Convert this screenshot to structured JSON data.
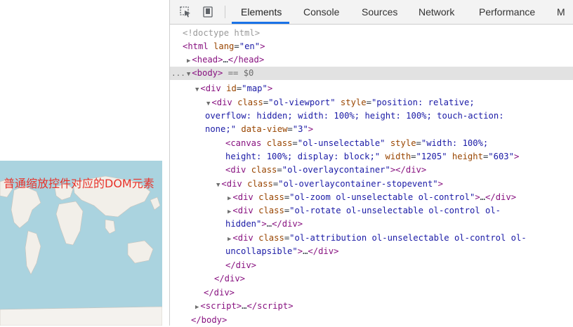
{
  "annotation": {
    "text": "普通缩放控件对应的DOM元素"
  },
  "devtools": {
    "tabs": [
      {
        "label": "Elements"
      },
      {
        "label": "Console"
      },
      {
        "label": "Sources"
      },
      {
        "label": "Network"
      },
      {
        "label": "Performance"
      },
      {
        "label": "M"
      }
    ],
    "active_tab": "Elements",
    "lines": {
      "doctype": "<!doctype html>",
      "html": {
        "tag": "html",
        "attr": "lang",
        "value": "en"
      },
      "head": {
        "text": "…"
      },
      "body": {
        "tag": "body",
        "marker": "== $0",
        "dots": "..."
      },
      "map_div": {
        "attr": "id",
        "value": "map"
      },
      "viewport": {
        "class": "ol-viewport",
        "style1": "position: relative;",
        "style2": "overflow: hidden; width: 100%; height: 100%; touch-action:",
        "style3": "none;",
        "view_attr": "data-view",
        "view_value": "3"
      },
      "canvas": {
        "class": "ol-unselectable",
        "style1": "width: 100%;",
        "style2": "height: 100%; display: block;",
        "width": "1205",
        "height": "603"
      },
      "overlay": {
        "class": "ol-overlaycontainer"
      },
      "overlay_stop": {
        "class": "ol-overlaycontainer-stopevent"
      },
      "zoom": {
        "class": "ol-zoom ol-unselectable ol-control"
      },
      "rotate": {
        "class1": "ol-rotate ol-unselectable ol-control ol-",
        "class2": "hidden"
      },
      "attribution": {
        "class1": "ol-attribution ol-unselectable ol-control ol-",
        "class2": "uncollapsible"
      },
      "ellipsis": "…",
      "script": {
        "tag": "script"
      }
    }
  }
}
